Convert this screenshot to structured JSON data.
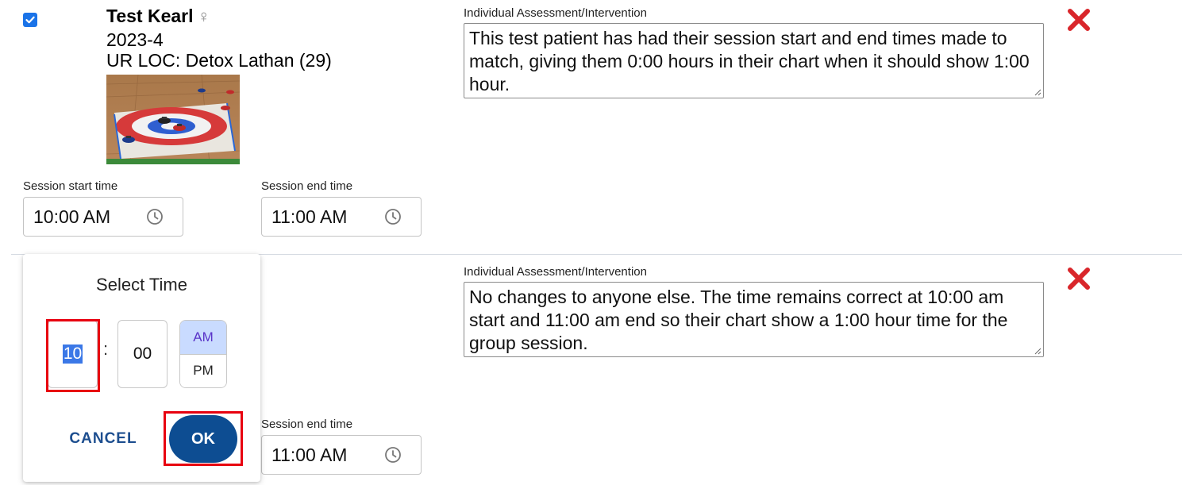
{
  "patient_card": {
    "name": "Test Kearl",
    "gender_symbol": "♀",
    "patient_id": "2023-4",
    "ur_loc": "UR LOC: Detox Lathan (29)",
    "checked": true,
    "assessment_label": "Individual Assessment/Intervention",
    "assessment_text": "This test patient has had their session start and end times made to match, giving them 0:00 hours in their chart when it should show 1:00 hour.",
    "start_label": "Session start time",
    "start_value": "10:00 AM",
    "end_label": "Session end time",
    "end_value": "11:00 AM"
  },
  "second_card": {
    "assessment_label": "Individual Assessment/Intervention",
    "assessment_text": "No changes to anyone else. The time remains correct at 10:00 am start and 11:00 am end so their chart show a 1:00 hour time for the group session.",
    "end_label": "Session end time",
    "end_value": "11:00 AM"
  },
  "time_picker": {
    "title": "Select Time",
    "hour": "10",
    "separator": ":",
    "minute": "00",
    "am_label": "AM",
    "pm_label": "PM",
    "selected_period": "AM",
    "cancel_label": "CANCEL",
    "ok_label": "OK"
  },
  "colors": {
    "accent": "#0d4d92",
    "selection": "#3b78e7",
    "delete": "#d9262b",
    "highlight_frame": "#e8000f",
    "am_selected_bg": "#c9dbff"
  },
  "icons": [
    "checkbox-checked-icon",
    "female-icon",
    "clock-icon",
    "delete-x-icon",
    "resize-grip-icon"
  ]
}
